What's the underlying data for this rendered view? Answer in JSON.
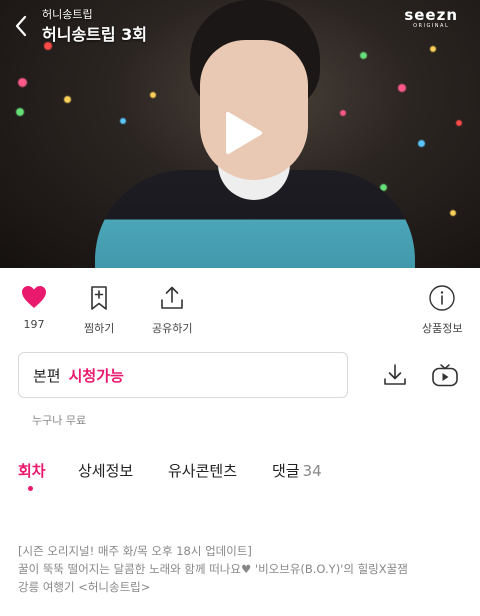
{
  "player": {
    "series_name": "허니송트립",
    "episode_title": "허니송트립 3회",
    "watermark_brand": "seezn",
    "watermark_sub": "ORIGINAL"
  },
  "actions": {
    "like_count": "197",
    "bookmark_label": "찜하기",
    "share_label": "공유하기",
    "info_label": "상품정보"
  },
  "watch": {
    "kind_label": "본편",
    "status_label": "시청가능",
    "price_note": "누구나 무료"
  },
  "tabs": [
    {
      "label": "회차"
    },
    {
      "label": "상세정보"
    },
    {
      "label": "유사콘텐츠"
    },
    {
      "label": "댓글",
      "count": "34"
    }
  ],
  "description": {
    "line1": "[시즌 오리지널! 매주 화/목 오후 18시 업데이트]",
    "line2": "꿀이 뚝뚝 떨어지는 달콤한 노래와 함께 떠나요♥ '비오브유(B.O.Y)'의 힐링X꿀잼",
    "line3": "강릉 여행기 <허니송트립>"
  },
  "colors": {
    "accent": "#e9196d",
    "like_heart": "#e9196d"
  }
}
